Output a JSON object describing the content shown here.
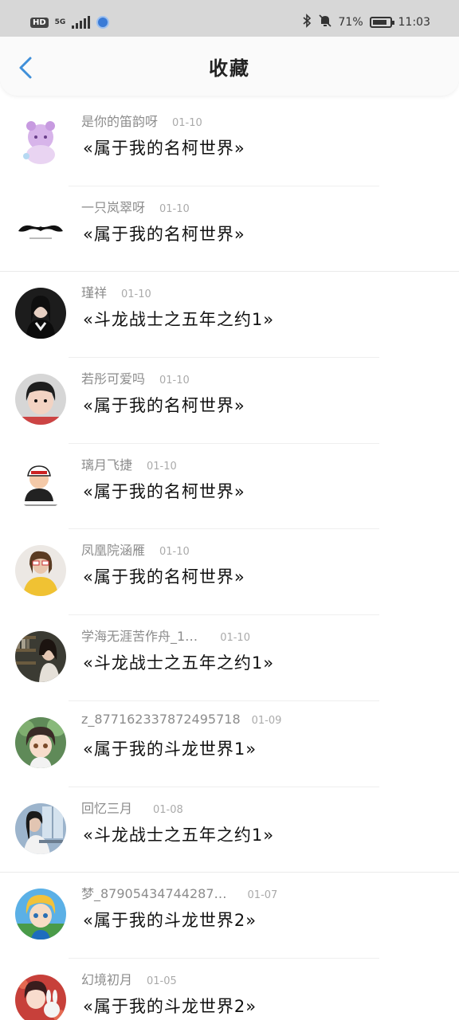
{
  "status_bar": {
    "hd": "HD",
    "network": "5G",
    "battery_pct": "71%",
    "time": "11:03"
  },
  "header": {
    "title": "收藏"
  },
  "favorites": [
    {
      "user": "是你的笛韵呀",
      "date": "01-10",
      "title": "«属于我的名柯世界»",
      "avatar": "anime-bear-avatar"
    },
    {
      "user": "一只岚翠呀",
      "date": "01-10",
      "title": "«属于我的名柯世界»",
      "avatar": "mustache-avatar"
    },
    {
      "user": "瑾祥",
      "date": "01-10",
      "title": "«斗龙战士之五年之约1»",
      "avatar": "portrait-avatar"
    },
    {
      "user": "若彤可爱吗",
      "date": "01-10",
      "title": "«属于我的名柯世界»",
      "avatar": "child-avatar"
    },
    {
      "user": "璃月飞捷",
      "date": "01-10",
      "title": "«属于我的名柯世界»",
      "avatar": "cartoon-avatar"
    },
    {
      "user": "凤凰院涵雁",
      "date": "01-10",
      "title": "«属于我的名柯世界»",
      "avatar": "sunglasses-avatar"
    },
    {
      "user": "学海无涯苦作舟_1…",
      "date": "01-10",
      "title": "«斗龙战士之五年之约1»",
      "avatar": "bookshelf-avatar"
    },
    {
      "user": "z_877162337872495718",
      "date": "01-09",
      "title": "«属于我的斗龙世界1»",
      "avatar": "anime-girl-avatar"
    },
    {
      "user": "回忆三月",
      "date": "01-08",
      "title": "«斗龙战士之五年之约1»",
      "avatar": "window-avatar"
    },
    {
      "user": "梦_87905434744287…",
      "date": "01-07",
      "title": "«属于我的斗龙世界2»",
      "avatar": "anime-boy-avatar"
    },
    {
      "user": "幻境初月",
      "date": "01-05",
      "title": "«属于我的斗龙世界2»",
      "avatar": "anime-bunny-avatar"
    }
  ],
  "colors": {
    "status_bar_bg": "#d7d7d7",
    "header_bg": "#fafafa",
    "back_icon": "#3f8fd9",
    "username": "#8c8c8c",
    "title_text": "#111111"
  }
}
